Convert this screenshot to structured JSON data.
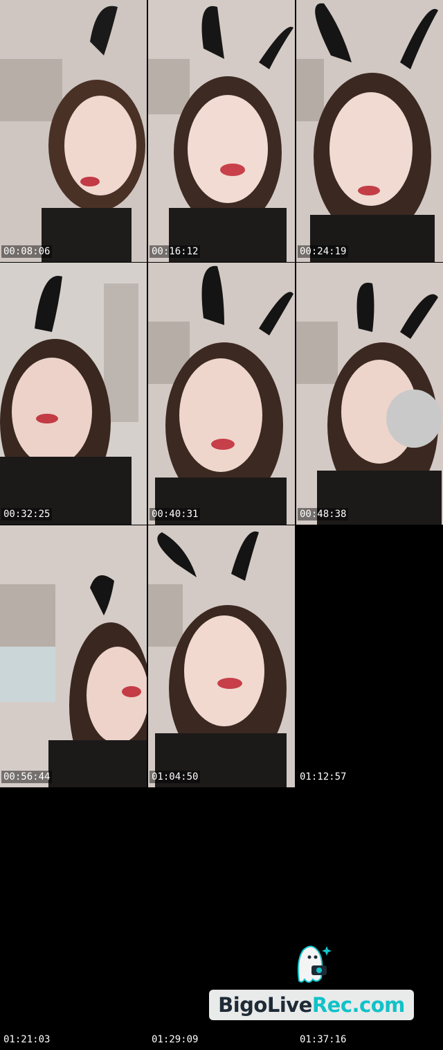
{
  "thumbnails": [
    {
      "timestamp": "00:08:06",
      "has_image": true
    },
    {
      "timestamp": "00:16:12",
      "has_image": true
    },
    {
      "timestamp": "00:24:19",
      "has_image": true
    },
    {
      "timestamp": "00:32:25",
      "has_image": true
    },
    {
      "timestamp": "00:40:31",
      "has_image": true
    },
    {
      "timestamp": "00:48:38",
      "has_image": true
    },
    {
      "timestamp": "00:56:44",
      "has_image": true
    },
    {
      "timestamp": "01:04:50",
      "has_image": true
    },
    {
      "timestamp": "01:12:57",
      "has_image": false
    },
    {
      "timestamp": "01:21:03",
      "has_image": false
    },
    {
      "timestamp": "01:29:09",
      "has_image": false
    },
    {
      "timestamp": "01:37:16",
      "has_image": false
    }
  ],
  "watermark": {
    "part1": "BigoLive",
    "part2": "Rec.com"
  },
  "colors": {
    "background": "#000000",
    "watermark_dark": "#1e2b36",
    "watermark_teal": "#10c2c8"
  }
}
